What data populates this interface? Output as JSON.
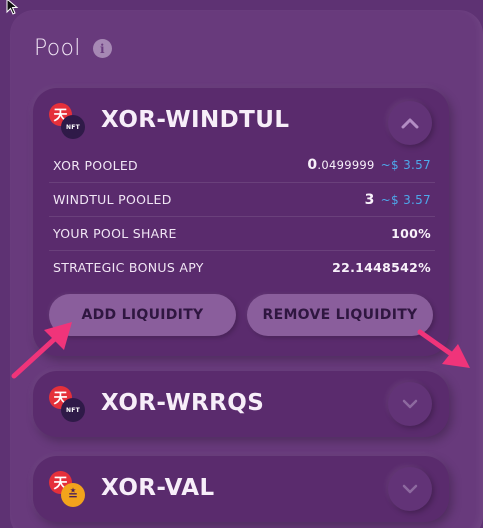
{
  "page": {
    "title": "Pool",
    "info_icon": "info-icon",
    "cursor_icon": "mouse-pointer-icon"
  },
  "pools": [
    {
      "name": "XOR-WINDTUL",
      "icon_a": "xor-icon",
      "icon_a_glyph": "天",
      "icon_b": "nft-token-icon",
      "icon_b_text": "NFT",
      "expanded": true,
      "rows": [
        {
          "label": "XOR POOLED",
          "value_int": "0",
          "value_dec": ".0499999",
          "fiat": "~$ 3.57"
        },
        {
          "label": "WINDTUL POOLED",
          "value_int": "3",
          "value_dec": "",
          "fiat": "~$ 3.57"
        },
        {
          "label": "YOUR POOL SHARE",
          "value_int": "100%",
          "value_dec": "",
          "fiat": ""
        },
        {
          "label": "STRATEGIC BONUS APY",
          "value_int": "22.1448542%",
          "value_dec": "",
          "fiat": ""
        }
      ],
      "add_label": "ADD LIQUIDITY",
      "remove_label": "REMOVE LIQUIDITY",
      "chevron_icon": "chevron-up-icon"
    },
    {
      "name": "XOR-WRRQS",
      "icon_a": "xor-icon",
      "icon_a_glyph": "天",
      "icon_b": "nft-token-icon",
      "icon_b_text": "NFT",
      "expanded": false,
      "chevron_icon": "chevron-down-icon"
    },
    {
      "name": "XOR-VAL",
      "icon_a": "xor-icon",
      "icon_a_glyph": "天",
      "icon_b": "val-token-icon",
      "icon_b_text": "≛",
      "expanded": false,
      "chevron_icon": "chevron-down-icon"
    }
  ],
  "annotations": {
    "arrow_icon": "pink-arrow-icon",
    "color": "#f0347a"
  },
  "colors": {
    "background": "#5e3273",
    "panel": "#683a7c",
    "card": "#5a2b6d",
    "button": "#8a5e9c",
    "fiat": "#4ea8ea",
    "xor_red": "#e5303a",
    "val_gold": "#f2a31c"
  }
}
